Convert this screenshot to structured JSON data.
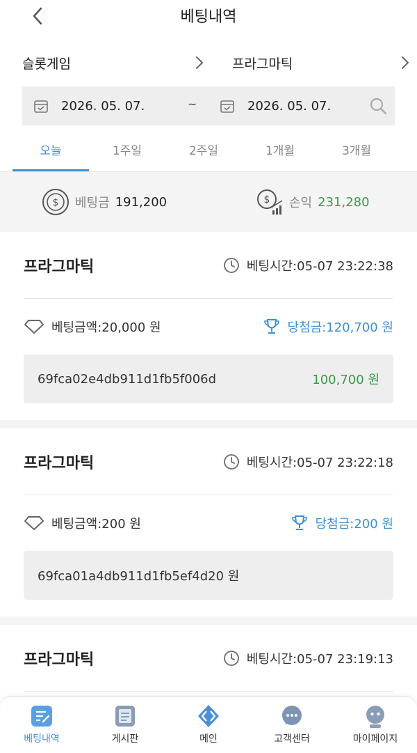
{
  "header": {
    "title": "베팅내역"
  },
  "selectors": {
    "category": "슬롯게임",
    "provider": "프라그마틱"
  },
  "dates": {
    "start": "2026. 05. 07.",
    "separator": "~",
    "end": "2026. 05. 07."
  },
  "tabs": [
    {
      "label": "오늘",
      "active": true
    },
    {
      "label": "1주일",
      "active": false
    },
    {
      "label": "2주일",
      "active": false
    },
    {
      "label": "1개월",
      "active": false
    },
    {
      "label": "3개월",
      "active": false
    }
  ],
  "summary": {
    "bet_label": "베팅금",
    "bet_value": "191,200",
    "profit_label": "손익",
    "profit_value": "231,280"
  },
  "bets": [
    {
      "title": "프라그마틱",
      "time": "베팅시간:05-07 23:22:38",
      "amount": "베팅금액:20,000 원",
      "win": "당첨금:120,700 원",
      "hash": "69fca02e4db911d1fb5f006d",
      "profit": "100,700 원"
    },
    {
      "title": "프라그마틱",
      "time": "베팅시간:05-07 23:22:18",
      "amount": "베팅금액:200 원",
      "win": "당첨금:200 원",
      "hash": "69fca01a4db911d1fb5ef4d20 원",
      "profit": ""
    },
    {
      "title": "프라그마틱",
      "time": "베팅시간:05-07 23:19:13"
    }
  ],
  "nav": [
    {
      "label": "베팅내역",
      "icon": "bet-history-icon",
      "active": true
    },
    {
      "label": "게시판",
      "icon": "board-icon",
      "active": false
    },
    {
      "label": "메인",
      "icon": "main-icon",
      "active": false
    },
    {
      "label": "고객센터",
      "icon": "support-icon",
      "active": false
    },
    {
      "label": "마이페이지",
      "icon": "mypage-icon",
      "active": false
    }
  ],
  "colors": {
    "accent": "#3d8fd6",
    "positive": "#3a9a4a",
    "summary_bg": "#f4f4f4",
    "field_bg": "#eeeeee"
  }
}
